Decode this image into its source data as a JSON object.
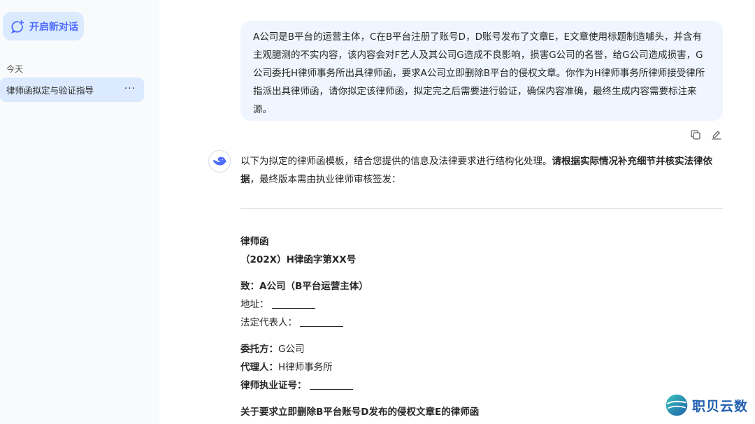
{
  "sidebar": {
    "new_chat_label": "开启新对话",
    "section_today": "今天",
    "conversation": {
      "title": "律师函拟定与验证指导",
      "more": "···"
    }
  },
  "user_message": "A公司是B平台的运营主体，C在B平台注册了账号D，D账号发布了文章E，E文章使用标题制造噱头，并含有主观臆测的不实内容，该内容会对F艺人及其公司G造成不良影响，损害G公司的名誉，给G公司造成损害，G公司委托H律师事务所出具律师函，要求A公司立即删除B平台的侵权文章。你作为H律师事务所律师接受律所指派出具律师函，请你拟定该律师函，拟定完之后需要进行验证，确保内容准确，最终生成内容需要标注来源。",
  "answer": {
    "intro_plain": "以下为拟定的律师函模板，结合您提供的信息及法律要求进行结构化处理。",
    "intro_bold": "请根据实际情况补充细节并核实法律依据",
    "intro_tail": "，最终版本需由执业律师审核签发：",
    "doc_title": "律师函",
    "doc_number": "（202X）H律函字第XX号",
    "to_line": "致：A公司（B平台运营主体）",
    "address_label": "地址：",
    "rep_label": "法定代表人：",
    "client_key": "委托方：",
    "client_val": "G公司",
    "agent_key": "代理人：",
    "agent_val": "H律师事务所",
    "license_key": "律师执业证号：",
    "subject": "关于要求立即删除B平台账号D发布的侵权文章E的律师函"
  },
  "watermark": {
    "text": "职贝云数"
  },
  "colors": {
    "accent": "#4d6bfe",
    "bubble": "#eff6ff",
    "sidebar": "#f9fafb",
    "highlight": "#dbeafe"
  }
}
